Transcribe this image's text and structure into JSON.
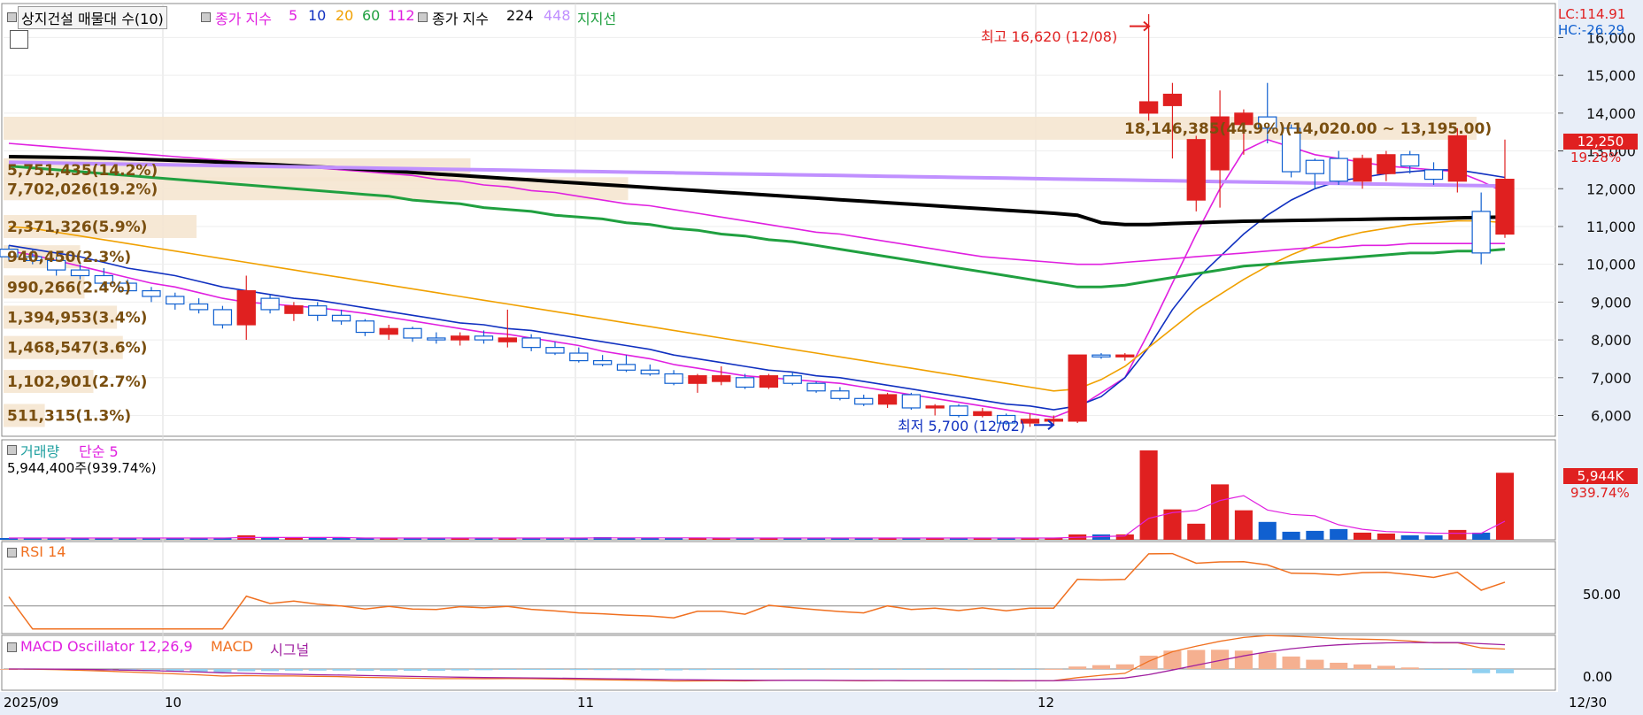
{
  "header": {
    "stock_label": "상지건설 매물대 수(10)",
    "close_index_prefix": "종가 지수",
    "ma_periods": [
      {
        "label": "5",
        "color": "#e020e0"
      },
      {
        "label": "10",
        "color": "#1030c0"
      },
      {
        "label": "20",
        "color": "#f0a000"
      },
      {
        "label": "60",
        "color": "#20a040"
      },
      {
        "label": "112",
        "color": "#e020e0"
      }
    ],
    "close_index_prefix2": "종가 지수",
    "ma2_periods": [
      {
        "label": "224",
        "color": "#000000"
      },
      {
        "label": "448",
        "color": "#c090ff"
      }
    ],
    "support_label": "지지선",
    "support_color": "#20a040",
    "lc_label": "LC:114.91",
    "hc_label": "HC:-26.29"
  },
  "annotations": {
    "high_label": "최고 16,620 (12/08)",
    "low_label": "최저 5,700 (12/02)",
    "current_price": "12,250",
    "current_change": "19.28%",
    "vol_current": "5,944K",
    "vol_change": "939.74%"
  },
  "volume_panel": {
    "title1": "거래량",
    "title2": "단순 5",
    "info": "5,944,400주(939.74%)"
  },
  "rsi_panel": {
    "title": "RSI 14",
    "level_label": "50.00"
  },
  "macd_panel": {
    "title1": "MACD Oscillator 12,26,9",
    "title2": "MACD",
    "title3": "시그널",
    "zero_label": "0.00"
  },
  "x_axis": {
    "labels": [
      "2025/09",
      "10",
      "11",
      "12",
      "12/30"
    ]
  },
  "chart_data": {
    "type": "candlestick",
    "y_axis_ticks": [
      6000,
      7000,
      8000,
      9000,
      10000,
      11000,
      12000,
      13000,
      14000,
      15000,
      16000
    ],
    "y_tick_labels": [
      "6,000",
      "7,000",
      "8,000",
      "9,000",
      "10,000",
      "11,000",
      "12,000",
      "13,000",
      "14,000",
      "15,000",
      "16,000"
    ],
    "price_range": [
      5450,
      16900
    ],
    "volume_profile": [
      {
        "label": "18,146,385(44.9%)(14,020.00 ~ 13,195.00)",
        "price": 13600,
        "frac": 1.0
      },
      {
        "label": "5,751,435(14.2%)",
        "price": 12500,
        "frac": 0.317
      },
      {
        "label": "7,702,026(19.2%)",
        "price": 12000,
        "frac": 0.424
      },
      {
        "label": "2,371,326(5.9%)",
        "price": 11000,
        "frac": 0.131
      },
      {
        "label": "940,450(2.3%)",
        "price": 10200,
        "frac": 0.052
      },
      {
        "label": "990,266(2.4%)",
        "price": 9400,
        "frac": 0.055
      },
      {
        "label": "1,394,953(3.4%)",
        "price": 8600,
        "frac": 0.077
      },
      {
        "label": "1,468,547(3.6%)",
        "price": 7800,
        "frac": 0.081
      },
      {
        "label": "1,102,901(2.7%)",
        "price": 6900,
        "frac": 0.061
      },
      {
        "label": "511,315(1.3%)",
        "price": 6000,
        "frac": 0.028
      }
    ],
    "candles": [
      {
        "o": 10400,
        "h": 10500,
        "l": 10100,
        "c": 10200,
        "v": 0.02
      },
      {
        "o": 10200,
        "h": 10400,
        "l": 10000,
        "c": 10100,
        "v": 0.02
      },
      {
        "o": 10100,
        "h": 10200,
        "l": 9700,
        "c": 9850,
        "v": 0.02
      },
      {
        "o": 9850,
        "h": 10000,
        "l": 9600,
        "c": 9700,
        "v": 0.02
      },
      {
        "o": 9700,
        "h": 9900,
        "l": 9400,
        "c": 9500,
        "v": 0.02
      },
      {
        "o": 9500,
        "h": 9600,
        "l": 9200,
        "c": 9300,
        "v": 0.02
      },
      {
        "o": 9300,
        "h": 9400,
        "l": 9000,
        "c": 9150,
        "v": 0.02
      },
      {
        "o": 9150,
        "h": 9250,
        "l": 8800,
        "c": 8950,
        "v": 0.02
      },
      {
        "o": 8950,
        "h": 9100,
        "l": 8700,
        "c": 8800,
        "v": 0.02
      },
      {
        "o": 8800,
        "h": 8900,
        "l": 8300,
        "c": 8400,
        "v": 0.02
      },
      {
        "o": 8400,
        "h": 9700,
        "l": 8000,
        "c": 9300,
        "v": 0.05
      },
      {
        "o": 9100,
        "h": 9200,
        "l": 8700,
        "c": 8800,
        "v": 0.02
      },
      {
        "o": 8700,
        "h": 9000,
        "l": 8500,
        "c": 8900,
        "v": 0.02
      },
      {
        "o": 8900,
        "h": 9000,
        "l": 8500,
        "c": 8650,
        "v": 0.02
      },
      {
        "o": 8650,
        "h": 8800,
        "l": 8400,
        "c": 8500,
        "v": 0.02
      },
      {
        "o": 8500,
        "h": 8550,
        "l": 8100,
        "c": 8200,
        "v": 0.02
      },
      {
        "o": 8150,
        "h": 8400,
        "l": 8000,
        "c": 8300,
        "v": 0.02
      },
      {
        "o": 8300,
        "h": 8350,
        "l": 7950,
        "c": 8050,
        "v": 0.02
      },
      {
        "o": 8050,
        "h": 8200,
        "l": 7900,
        "c": 8000,
        "v": 0.02
      },
      {
        "o": 8000,
        "h": 8200,
        "l": 7850,
        "c": 8100,
        "v": 0.02
      },
      {
        "o": 8100,
        "h": 8250,
        "l": 7900,
        "c": 8000,
        "v": 0.02
      },
      {
        "o": 7950,
        "h": 8800,
        "l": 7800,
        "c": 8050,
        "v": 0.02
      },
      {
        "o": 8050,
        "h": 8150,
        "l": 7700,
        "c": 7800,
        "v": 0.02
      },
      {
        "o": 7800,
        "h": 7950,
        "l": 7600,
        "c": 7650,
        "v": 0.02
      },
      {
        "o": 7650,
        "h": 7800,
        "l": 7400,
        "c": 7450,
        "v": 0.02
      },
      {
        "o": 7450,
        "h": 7600,
        "l": 7300,
        "c": 7350,
        "v": 0.03
      },
      {
        "o": 7350,
        "h": 7600,
        "l": 7150,
        "c": 7200,
        "v": 0.02
      },
      {
        "o": 7200,
        "h": 7350,
        "l": 7050,
        "c": 7100,
        "v": 0.02
      },
      {
        "o": 7100,
        "h": 7200,
        "l": 6800,
        "c": 6850,
        "v": 0.02
      },
      {
        "o": 6850,
        "h": 7100,
        "l": 6600,
        "c": 7050,
        "v": 0.02
      },
      {
        "o": 6900,
        "h": 7300,
        "l": 6800,
        "c": 7050,
        "v": 0.02
      },
      {
        "o": 7000,
        "h": 7100,
        "l": 6700,
        "c": 6750,
        "v": 0.02
      },
      {
        "o": 6750,
        "h": 7100,
        "l": 6700,
        "c": 7050,
        "v": 0.02
      },
      {
        "o": 7050,
        "h": 7150,
        "l": 6800,
        "c": 6850,
        "v": 0.02
      },
      {
        "o": 6850,
        "h": 6900,
        "l": 6600,
        "c": 6650,
        "v": 0.02
      },
      {
        "o": 6650,
        "h": 6750,
        "l": 6400,
        "c": 6450,
        "v": 0.02
      },
      {
        "o": 6450,
        "h": 6550,
        "l": 6250,
        "c": 6300,
        "v": 0.02
      },
      {
        "o": 6300,
        "h": 6600,
        "l": 6200,
        "c": 6550,
        "v": 0.02
      },
      {
        "o": 6550,
        "h": 6600,
        "l": 6150,
        "c": 6200,
        "v": 0.02
      },
      {
        "o": 6200,
        "h": 6300,
        "l": 6000,
        "c": 6250,
        "v": 0.02
      },
      {
        "o": 6250,
        "h": 6300,
        "l": 5950,
        "c": 6000,
        "v": 0.02
      },
      {
        "o": 6000,
        "h": 6200,
        "l": 5950,
        "c": 6100,
        "v": 0.02
      },
      {
        "o": 6000,
        "h": 6050,
        "l": 5750,
        "c": 5800,
        "v": 0.02
      },
      {
        "o": 5800,
        "h": 6050,
        "l": 5700,
        "c": 5900,
        "v": 0.02
      },
      {
        "o": 5850,
        "h": 6000,
        "l": 5750,
        "c": 5900,
        "v": 0.02
      },
      {
        "o": 5850,
        "h": 7600,
        "l": 5800,
        "c": 7600,
        "v": 0.06
      },
      {
        "o": 7600,
        "h": 7650,
        "l": 7500,
        "c": 7550,
        "v": 0.06
      },
      {
        "o": 7550,
        "h": 7650,
        "l": 7450,
        "c": 7600,
        "v": 0.06
      },
      {
        "o": 14000,
        "h": 16620,
        "l": 13800,
        "c": 14300,
        "v": 1.0
      },
      {
        "o": 14200,
        "h": 14800,
        "l": 12800,
        "c": 14500,
        "v": 0.34
      },
      {
        "o": 11700,
        "h": 13400,
        "l": 11400,
        "c": 13300,
        "v": 0.18
      },
      {
        "o": 12500,
        "h": 14600,
        "l": 11500,
        "c": 13900,
        "v": 0.62
      },
      {
        "o": 13700,
        "h": 14100,
        "l": 12900,
        "c": 14000,
        "v": 0.33
      },
      {
        "o": 13900,
        "h": 14800,
        "l": 13200,
        "c": 13600,
        "v": 0.2
      },
      {
        "o": 13600,
        "h": 13700,
        "l": 12300,
        "c": 12450,
        "v": 0.09
      },
      {
        "o": 12750,
        "h": 12800,
        "l": 12000,
        "c": 12400,
        "v": 0.1
      },
      {
        "o": 12800,
        "h": 13000,
        "l": 12100,
        "c": 12200,
        "v": 0.12
      },
      {
        "o": 12200,
        "h": 12900,
        "l": 12000,
        "c": 12800,
        "v": 0.08
      },
      {
        "o": 12400,
        "h": 13000,
        "l": 12200,
        "c": 12900,
        "v": 0.07
      },
      {
        "o": 12900,
        "h": 13000,
        "l": 12400,
        "c": 12600,
        "v": 0.05
      },
      {
        "o": 12500,
        "h": 12700,
        "l": 12100,
        "c": 12250,
        "v": 0.05
      },
      {
        "o": 12200,
        "h": 13600,
        "l": 11900,
        "c": 13400,
        "v": 0.11
      },
      {
        "o": 11400,
        "h": 11900,
        "l": 10000,
        "c": 10300,
        "v": 0.08
      },
      {
        "o": 10800,
        "h": 13300,
        "l": 10700,
        "c": 12250,
        "v": 0.75
      }
    ],
    "ma_lines": [
      {
        "name": "5",
        "color": "#e020e0",
        "values": [
          10350,
          10250,
          10100,
          9950,
          9800,
          9650,
          9500,
          9400,
          9250,
          9100,
          9000,
          8950,
          8900,
          8850,
          8780,
          8700,
          8600,
          8500,
          8400,
          8300,
          8200,
          8150,
          8050,
          7950,
          7850,
          7700,
          7600,
          7500,
          7350,
          7250,
          7150,
          7050,
          7000,
          6950,
          6900,
          6850,
          6750,
          6650,
          6550,
          6450,
          6350,
          6250,
          6150,
          6050,
          5950,
          6200,
          6600,
          7000,
          8200,
          9500,
          10800,
          12000,
          13000,
          13300,
          13100,
          12900,
          12800,
          12700,
          12600,
          12550,
          12500,
          12450,
          12200,
          11900
        ]
      },
      {
        "name": "10",
        "color": "#1030c0",
        "values": [
          10500,
          10400,
          10300,
          10200,
          10050,
          9900,
          9800,
          9700,
          9550,
          9400,
          9300,
          9200,
          9100,
          9050,
          8950,
          8850,
          8750,
          8650,
          8550,
          8450,
          8400,
          8300,
          8250,
          8150,
          8050,
          7950,
          7850,
          7750,
          7600,
          7500,
          7400,
          7300,
          7200,
          7150,
          7050,
          7000,
          6900,
          6800,
          6700,
          6600,
          6500,
          6400,
          6300,
          6250,
          6150,
          6250,
          6500,
          7000,
          7800,
          8800,
          9600,
          10200,
          10800,
          11300,
          11700,
          12000,
          12200,
          12300,
          12400,
          12450,
          12500,
          12500,
          12400,
          12300
        ]
      },
      {
        "name": "20",
        "color": "#f0a000",
        "values": [
          11000,
          10950,
          10850,
          10750,
          10650,
          10550,
          10450,
          10350,
          10250,
          10150,
          10050,
          9950,
          9850,
          9750,
          9650,
          9550,
          9450,
          9350,
          9250,
          9150,
          9050,
          8950,
          8850,
          8750,
          8650,
          8550,
          8450,
          8350,
          8250,
          8150,
          8050,
          7950,
          7850,
          7750,
          7650,
          7550,
          7450,
          7350,
          7250,
          7150,
          7050,
          6950,
          6850,
          6750,
          6650,
          6700,
          6950,
          7300,
          7800,
          8300,
          8800,
          9200,
          9600,
          9950,
          10250,
          10500,
          10700,
          10850,
          10950,
          11050,
          11100,
          11150,
          11150,
          11100
        ]
      },
      {
        "name": "60",
        "color": "#20a040",
        "values": [
          12600,
          12550,
          12500,
          12450,
          12400,
          12350,
          12300,
          12250,
          12200,
          12150,
          12100,
          12050,
          12000,
          11950,
          11900,
          11850,
          11800,
          11700,
          11650,
          11600,
          11500,
          11450,
          11400,
          11300,
          11250,
          11200,
          11100,
          11050,
          10950,
          10900,
          10800,
          10750,
          10650,
          10600,
          10500,
          10400,
          10300,
          10200,
          10100,
          10000,
          9900,
          9800,
          9700,
          9600,
          9500,
          9400,
          9400,
          9450,
          9550,
          9650,
          9750,
          9850,
          9950,
          10000,
          10050,
          10100,
          10150,
          10200,
          10250,
          10300,
          10300,
          10350,
          10350,
          10400
        ]
      },
      {
        "name": "112",
        "color": "#e020e0",
        "values": [
          13200,
          13150,
          13100,
          13050,
          13000,
          12950,
          12900,
          12850,
          12800,
          12750,
          12700,
          12650,
          12600,
          12550,
          12500,
          12450,
          12400,
          12350,
          12250,
          12200,
          12100,
          12050,
          11950,
          11900,
          11800,
          11700,
          11600,
          11550,
          11450,
          11350,
          11250,
          11150,
          11050,
          10950,
          10850,
          10800,
          10700,
          10600,
          10500,
          10400,
          10300,
          10200,
          10150,
          10100,
          10050,
          10000,
          10000,
          10050,
          10100,
          10150,
          10200,
          10250,
          10300,
          10350,
          10400,
          10450,
          10450,
          10500,
          10500,
          10550,
          10550,
          10550,
          10550,
          10550
        ]
      },
      {
        "name": "224",
        "color": "#000000",
        "values": [
          12850,
          12840,
          12830,
          12820,
          12810,
          12790,
          12770,
          12750,
          12730,
          12700,
          12670,
          12640,
          12610,
          12580,
          12550,
          12510,
          12470,
          12430,
          12390,
          12350,
          12310,
          12270,
          12230,
          12190,
          12150,
          12110,
          12070,
          12030,
          11990,
          11950,
          11910,
          11870,
          11830,
          11790,
          11750,
          11710,
          11670,
          11630,
          11590,
          11550,
          11510,
          11470,
          11430,
          11390,
          11350,
          11300,
          11100,
          11050,
          11050,
          11080,
          11100,
          11120,
          11140,
          11150,
          11160,
          11170,
          11180,
          11190,
          11200,
          11210,
          11220,
          11230,
          11240,
          11250
        ]
      },
      {
        "name": "448",
        "color": "#c090ff",
        "values": [
          12700,
          12690,
          12680,
          12670,
          12660,
          12650,
          12640,
          12630,
          12620,
          12610,
          12600,
          12590,
          12580,
          12570,
          12560,
          12550,
          12540,
          12530,
          12520,
          12510,
          12500,
          12490,
          12480,
          12470,
          12460,
          12450,
          12440,
          12430,
          12420,
          12410,
          12400,
          12390,
          12380,
          12370,
          12360,
          12350,
          12340,
          12330,
          12320,
          12310,
          12300,
          12290,
          12280,
          12270,
          12260,
          12250,
          12240,
          12230,
          12220,
          12210,
          12200,
          12190,
          12180,
          12170,
          12160,
          12150,
          12140,
          12130,
          12120,
          12110,
          12100,
          12090,
          12080,
          12070
        ]
      }
    ]
  },
  "colors": {
    "up": "#e02020",
    "down": "#1060d0",
    "grid": "#dcdcdc",
    "profile": "#f5e6d0",
    "axis_bg": "#e8eef8"
  }
}
